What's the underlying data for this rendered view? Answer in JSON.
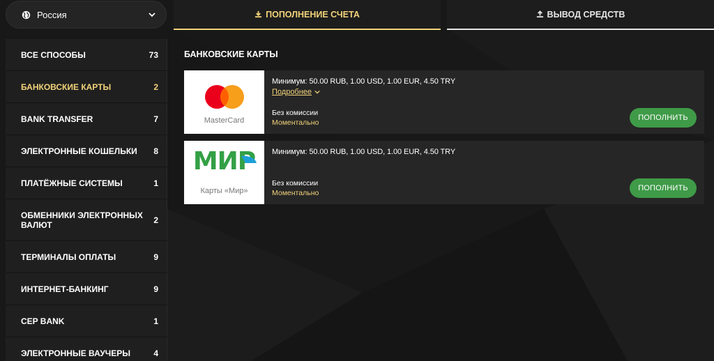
{
  "country_selector": {
    "value": "Россия",
    "icon": "globe-icon",
    "chevron": "chevron-down-icon"
  },
  "tabs": [
    {
      "label": "ПОПОЛНЕНИЕ СЧЕТА",
      "icon": "download-icon",
      "active": true
    },
    {
      "label": "ВЫВОД СРЕДСТВ",
      "icon": "upload-icon",
      "active": false
    }
  ],
  "categories": [
    {
      "label": "ВСЕ СПОСОБЫ",
      "count": "73"
    },
    {
      "label": "БАНКОВСКИЕ КАРТЫ",
      "count": "2",
      "active": true
    },
    {
      "label": "BANK TRANSFER",
      "count": "7"
    },
    {
      "label": "ЭЛЕКТРОННЫЕ КОШЕЛЬКИ",
      "count": "8"
    },
    {
      "label": "ПЛАТЁЖНЫЕ СИСТЕМЫ",
      "count": "1"
    },
    {
      "label": "ОБМЕННИКИ ЭЛЕКТРОННЫХ ВАЛЮТ",
      "count": "2"
    },
    {
      "label": "ТЕРМИНАЛЫ ОПЛАТЫ",
      "count": "9"
    },
    {
      "label": "ИНТЕРНЕТ-БАНКИНГ",
      "count": "9"
    },
    {
      "label": "CEP BANK",
      "count": "1"
    },
    {
      "label": "ЭЛЕКТРОННЫЕ ВАУЧЕРЫ",
      "count": "4"
    }
  ],
  "section_title": "БАНКОВСКИЕ КАРТЫ",
  "methods": [
    {
      "logo": "mastercard-logo",
      "caption": "MasterCard",
      "minimum": "Минимум: 50.00 RUB, 1.00 USD, 1.00 EUR, 4.50 TRY",
      "more": "Подробнее",
      "fee": "Без комиссии",
      "speed": "Моментально",
      "button": "ПОПОЛНИТЬ"
    },
    {
      "logo": "mir-logo",
      "logo_text": "МИР",
      "caption": "Карты «Мир»",
      "minimum": "Минимум: 50.00 RUB, 1.00 USD, 1.00 EUR, 4.50 TRY",
      "fee": "Без комиссии",
      "speed": "Моментально",
      "button": "ПОПОЛНИТЬ"
    }
  ],
  "colors": {
    "accent": "#f2d37a",
    "button_green": "#3f9b48",
    "background": "#181818",
    "panel": "#262626"
  }
}
